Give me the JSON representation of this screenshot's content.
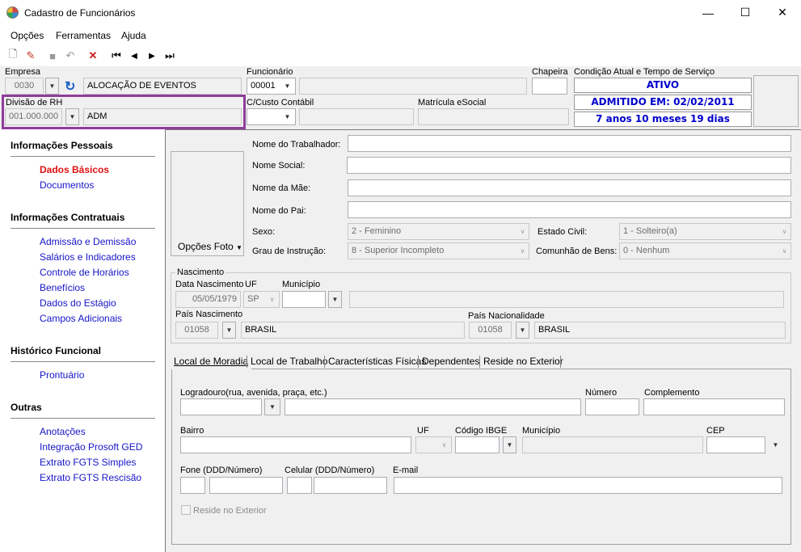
{
  "window": {
    "title": "Cadastro de Funcionários",
    "minimize": "—",
    "maximize": "☐",
    "close": "✕"
  },
  "menu": {
    "opcoes": "Opções",
    "ferramentas": "Ferramentas",
    "ajuda": "Ajuda"
  },
  "toolbar": {
    "new": "🗋",
    "edit": "✎",
    "save": "■",
    "undo": "↶",
    "delete": "✕",
    "first": "⏮",
    "prev": "◀",
    "next": "▶",
    "last": "⏭"
  },
  "header": {
    "empresa_label": "Empresa",
    "empresa_code": "0030",
    "empresa_name": "ALOCAÇÃO DE EVENTOS",
    "funcionario_label": "Funcionário",
    "funcionario_code": "00001",
    "funcionario_name": "",
    "chapeira_label": "Chapeira",
    "chapeira_value": "",
    "condicao_label": "Condição Atual e Tempo de Serviço",
    "status_ativo": "ATIVO",
    "status_admitido": "ADMITIDO EM: 02/02/2011",
    "status_tempo": "7 anos 10 meses 19 dias",
    "divisao_label": "Divisão de RH",
    "divisao_code": "001.000.000",
    "divisao_name": "ADM",
    "ccusto_label": "C/Custo Contábil",
    "ccusto_value": "",
    "matricula_label": "Matrícula eSocial",
    "matricula_value": ""
  },
  "sidebar": {
    "sec1": "Informações Pessoais",
    "dados_basicos": "Dados Básicos",
    "documentos": "Documentos",
    "sec2": "Informações Contratuais",
    "admissao": "Admissão e Demissão",
    "salarios": "Salários e Indicadores",
    "controle": "Controle de Horários",
    "beneficios": "Benefícios",
    "estagio": "Dados do Estágio",
    "campos": "Campos Adicionais",
    "sec3": "Histórico Funcional",
    "prontuario": "Prontuário",
    "sec4": "Outras",
    "anotacoes": "Anotações",
    "integracao": "Integração Prosoft GED",
    "extrato_simples": "Extrato FGTS Simples",
    "extrato_rescisao": "Extrato FGTS Rescisão"
  },
  "form": {
    "opcoes_foto": "Opções Foto",
    "nome_trabalhador": "Nome do Trabalhador:",
    "nome_social": "Nome Social:",
    "nome_mae": "Nome da Mãe:",
    "nome_pai": "Nome do Pai:",
    "sexo_label": "Sexo:",
    "sexo_value": "2 - Feminino",
    "estado_civil_label": "Estado Civil:",
    "estado_civil_value": "1 - Solteiro(a)",
    "grau_label": "Grau de Instrução:",
    "grau_value": "8 - Superior Incompleto",
    "comunhao_label": "Comunhão de Bens:",
    "comunhao_value": "0 - Nenhum"
  },
  "nascimento": {
    "group": "Nascimento",
    "data_label": "Data Nascimento",
    "data_value": "05/05/1979",
    "uf_label": "UF",
    "uf_value": "SP",
    "municipio_label": "Município",
    "pais_label": "País Nascimento",
    "pais_code": "01058",
    "pais_name": "BRASIL",
    "nac_label": "País Nacionalidade",
    "nac_code": "01058",
    "nac_name": "BRASIL"
  },
  "tabs": [
    "Local de Moradia",
    "Local de Trabalho",
    "Características Físicas",
    "Dependentes",
    "Reside no Exterior"
  ],
  "moradia": {
    "logradouro": "Logradouro(rua, avenida, praça, etc.)",
    "numero": "Número",
    "complemento": "Complemento",
    "bairro": "Bairro",
    "uf": "UF",
    "ibge": "Código IBGE",
    "municipio": "Município",
    "cep": "CEP",
    "fone": "Fone (DDD/Número)",
    "celular": "Celular (DDD/Número)",
    "email": "E-mail",
    "reside": "Reside no Exterior"
  },
  "colors": {
    "highlight": "#8e3d9a",
    "link": "#1515c8",
    "active": "#e01010",
    "status": "#0000cc"
  }
}
